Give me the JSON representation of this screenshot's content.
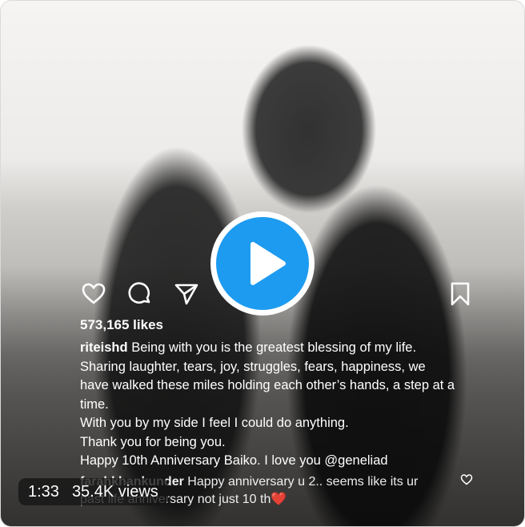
{
  "post": {
    "likes": "573,165 likes",
    "username": "riteishd",
    "caption_lines": [
      " Being with you is the greatest blessing of my life.",
      "Sharing laughter, tears, joy, struggles, fears, happiness, we",
      "have walked these miles holding each other’s hands, a step at a",
      "time.",
      "With you by my side I feel I could do anything.",
      "Thank you for being you.",
      "Happy 10th Anniversary Baiko. I love you @geneliad"
    ],
    "comment_user": "farahkhankunder",
    "comment_line1": " Happy anniversary u 2.. seems like its ur",
    "comment_line2": "past life anniversary not just 10 th",
    "comment_emoji": "❤️"
  },
  "video": {
    "duration": "1:33",
    "views": "35.4K views"
  },
  "icons": {
    "like": "heart-icon",
    "comment": "comment-icon",
    "share": "send-icon",
    "save": "bookmark-icon",
    "play": "play-icon"
  },
  "colors": {
    "play_button": "#1d9bf0",
    "text": "#ffffff"
  }
}
